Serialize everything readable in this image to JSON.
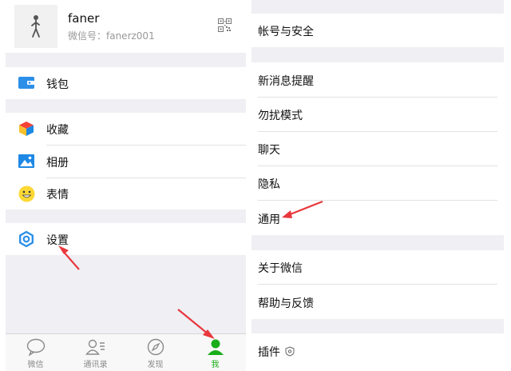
{
  "profile": {
    "name": "faner",
    "wechat_id": "微信号：fanerz001"
  },
  "left_menu": {
    "wallet": "钱包",
    "favorites": "收藏",
    "album": "相册",
    "stickers": "表情",
    "settings": "设置"
  },
  "tabbar": {
    "tabs": [
      {
        "label": "微信",
        "icon": "chat-bubble-icon"
      },
      {
        "label": "通讯录",
        "icon": "contacts-icon"
      },
      {
        "label": "发现",
        "icon": "compass-icon"
      },
      {
        "label": "我",
        "icon": "person-icon"
      }
    ],
    "active_color": "#1aad19"
  },
  "settings_menu": {
    "account_security": "帐号与安全",
    "new_message_alerts": "新消息提醒",
    "do_not_disturb": "勿扰模式",
    "chat": "聊天",
    "privacy": "隐私",
    "general": "通用",
    "about": "关于微信",
    "help_feedback": "帮助与反馈",
    "plugins": "插件"
  },
  "annotation_color": "#e8383d"
}
